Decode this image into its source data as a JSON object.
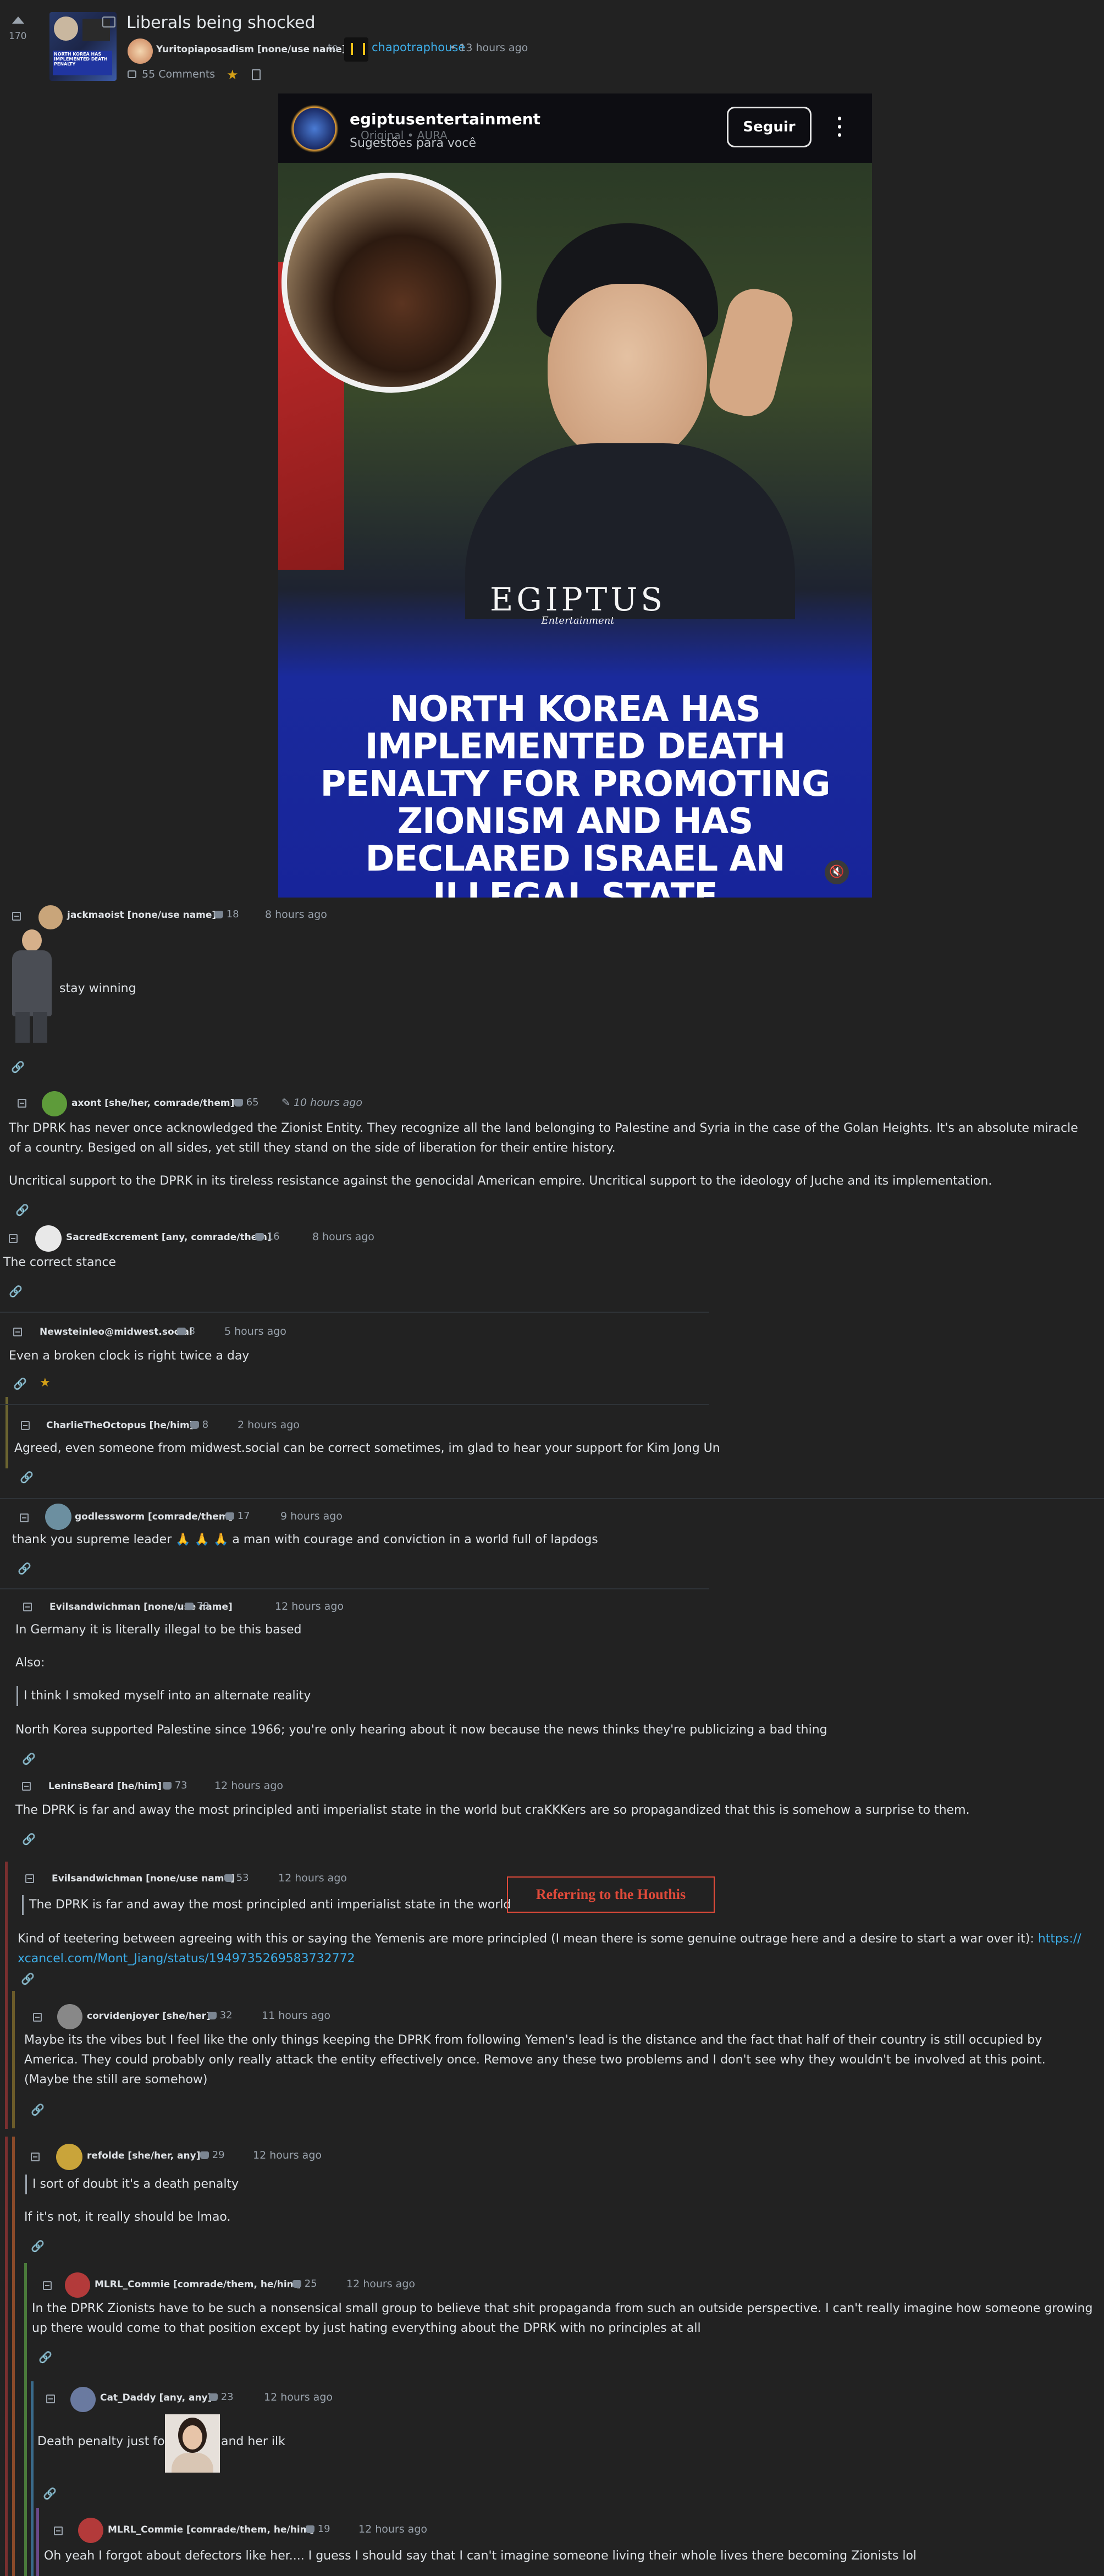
{
  "post": {
    "title": "Liberals being shocked",
    "score": "170",
    "author": "Yuritopiaposadism [none/use name]",
    "to_word": "to",
    "community": "chapotraphouse",
    "time": "13 hours ago",
    "comments_count": "55 Comments",
    "embed": {
      "account": "egiptusentertainment",
      "subtitle": "Sugestões para você",
      "sub2": "Original • AURA",
      "follow": "Seguir",
      "brand": "EGIPTUS",
      "brand_sub": "Entertainment",
      "headline": "NORTH KOREA HAS IMPLEMENTED DEATH PENALTY FOR PROMOTING ZIONISM AND HAS DECLARED ISRAEL AN ILLEGAL STATE"
    }
  },
  "comments": [
    {
      "user": "jackmaoist [none/use name]",
      "score": "18",
      "time": "8 hours ago",
      "lines": [
        "stay winning"
      ]
    },
    {
      "user": "axont [she/her, comrade/them]",
      "score": "65",
      "time": "10 hours ago",
      "lines": [
        "Thr DPRK has never once acknowledged the Zionist Entity. They recognize all the land belonging to Palestine and Syria in the case of the Golan Heights. It's an absolute miracle of a country. Besiged on all sides, yet still they stand on the side of liberation for their entire history.",
        "Uncritical support to the DPRK in its tireless resistance against the genocidal American empire. Uncritical support to the ideology of Juche and its implementation."
      ]
    },
    {
      "user": "SacredExcrement [any, comrade/them]",
      "score": "16",
      "time": "8 hours ago",
      "lines": [
        "The correct stance"
      ]
    },
    {
      "user": "Newsteinleo@midwest.social",
      "score": "3",
      "time": "5 hours ago",
      "lines": [
        "Even a broken clock is right twice a day"
      ]
    },
    {
      "user": "CharlieTheOctopus [he/him]",
      "score": "8",
      "time": "2 hours ago",
      "lines": [
        "Agreed, even someone from midwest.social can be correct sometimes, im glad to hear your support for Kim Jong Un"
      ]
    },
    {
      "user": "godlessworm [comrade/them]",
      "score": "17",
      "time": "9 hours ago",
      "lines": [
        "thank you supreme leader 🙏 🙏 🙏 a man with courage and conviction in a world full of lapdogs"
      ]
    },
    {
      "user": "Evilsandwichman [none/use name]",
      "score": "78",
      "time": "12 hours ago",
      "lines": [
        "In Germany it is literally illegal to be this based",
        "Also:",
        "I think I smoked myself into an alternate reality",
        "North Korea supported Palestine since 1966; you're only hearing about it now because the news thinks they're publicizing a bad thing"
      ]
    },
    {
      "user": "LeninsBeard [he/him]",
      "score": "73",
      "time": "12 hours ago",
      "lines": [
        "The DPRK is far and away the most principled anti imperialist state in the world but craKKKers are so propagandized that this is somehow a surprise to them."
      ]
    },
    {
      "user": "Evilsandwichman [none/use name]",
      "score": "53",
      "time": "12 hours ago",
      "lines": [
        "The DPRK is far and away the most principled anti imperialist state in the world",
        "Kind of teetering between agreeing with this or saying the Yemenis are more principled (I mean there is some genuine outrage here and a desire to start a war over it): ",
        "xcancel.com/Mont_Jiang/status/1949735269583732772"
      ],
      "link": "https://",
      "badge": "Referring to the Houthis"
    },
    {
      "user": "corvidenjoyer [she/her]",
      "score": "32",
      "time": "11 hours ago",
      "lines": [
        "Maybe its the vibes but I feel like the only things keeping the DPRK from following Yemen's lead is the distance and the fact that half of their country is still occupied by America. They could probably only really attack the entity effectively once. Remove any these two problems and I don't see why they wouldn't be involved at this point. (Maybe the still are somehow)"
      ]
    },
    {
      "user": "refolde [she/her, any]",
      "score": "29",
      "time": "12 hours ago",
      "lines": [
        "I sort of doubt it's a death penalty",
        "If it's not, it really should be lmao."
      ]
    },
    {
      "user": "MLRL_Commie [comrade/them, he/him]",
      "score": "25",
      "time": "12 hours ago",
      "lines": [
        "In the DPRK Zionists have to be such a nonsensical small group to believe that shit propaganda from such an outside perspective. I can't really imagine how someone growing up there would come to that position except by just hating everything about the DPRK with no principles at all"
      ]
    },
    {
      "user": "Cat_Daddy [any, any]",
      "score": "23",
      "time": "12 hours ago",
      "lines": [
        "Death penalty just for",
        "and her ilk"
      ]
    },
    {
      "user": "MLRL_Commie [comrade/them, he/him]",
      "score": "19",
      "time": "12 hours ago",
      "lines": [
        "Oh yeah I forgot about defectors like her.... I guess I should say that I can't imagine someone living their whole lives there becoming Zionists lol"
      ]
    }
  ],
  "colors": {
    "bg": "#222222",
    "link": "#3daee9",
    "muted": "#9aa3ad",
    "accent_red": "#e04a3a",
    "thread_green": "#4a7a3a",
    "thread_red": "#7a2f2f"
  }
}
